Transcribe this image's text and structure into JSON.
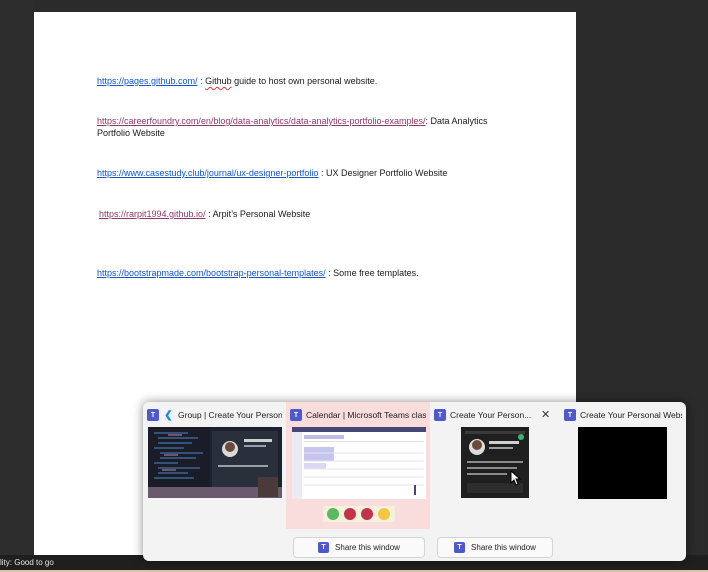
{
  "document": {
    "lines": [
      {
        "link": "https://pages.github.com/",
        "text_prefix": " :  ",
        "squiggle_word": "Github",
        "text": " guide to host own personal website."
      },
      {
        "link": "https://careerfoundry.com/en/blog/data-analytics/data-analytics-portfolio-examples/",
        "text": ": Data Analytics Portfolio Website"
      },
      {
        "link": "https://www.casestudy.club/journal/ux-designer-portfolio",
        "text": " : UX Designer Portfolio Website"
      },
      {
        "link": "https://rarpit1994.github.io/",
        "text": " : Arpit’s Personal Website"
      },
      {
        "link": "https://bootstrapmade.com/bootstrap-personal-templates/",
        "text": " : Some free templates."
      }
    ]
  },
  "status_bar": {
    "text": "lity: Good to go"
  },
  "taskbar_preview": {
    "windows": [
      {
        "title": "Group | Create Your Person...",
        "icon": "teams-icon",
        "secondary_icon": "vscode-icon"
      },
      {
        "title": "Calendar | Microsoft Teams clas...",
        "icon": "teams-icon"
      },
      {
        "title": "Create Your Person...",
        "icon": "teams-icon",
        "close": "✕"
      },
      {
        "title": "Create Your Personal Webs...",
        "icon": "teams-icon"
      }
    ],
    "share_buttons": [
      {
        "label": "Share this window"
      },
      {
        "label": "Share this window"
      }
    ],
    "colors": {
      "active_thumb": "#f9dcdc",
      "teams": "#5059c9",
      "link": "#1155cc",
      "visited_link": "#8e3a6a"
    }
  }
}
